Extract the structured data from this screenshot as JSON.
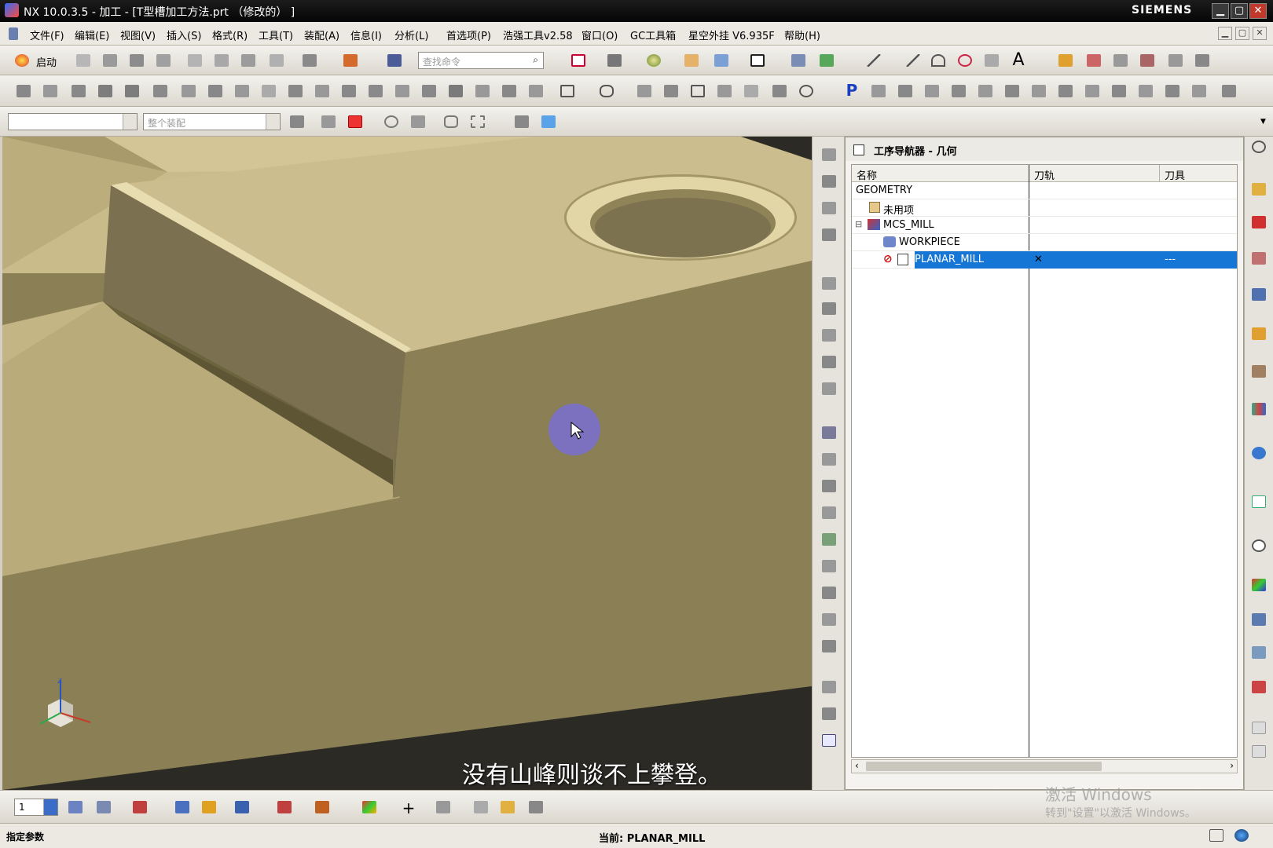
{
  "titlebar": {
    "title": "NX 10.0.3.5 - 加工 - [T型槽加工方法.prt （修改的） ]",
    "brand": "SIEMENS",
    "min": "▁",
    "max": "▢",
    "close": "✕"
  },
  "menu": [
    "文件(F)",
    "编辑(E)",
    "视图(V)",
    "插入(S)",
    "格式(R)",
    "工具(T)",
    "装配(A)",
    "信息(I)",
    "分析(L)",
    "首选项(P)",
    "浩强工具v2.58",
    "窗口(O)",
    "GC工具箱",
    "星空外挂 V6.935F",
    "帮助(H)"
  ],
  "toolbar": {
    "start_label": "启动",
    "search_placeholder": "查找命令",
    "filter_combo": "",
    "assembly_combo": "整个装配"
  },
  "viewport": {
    "subtitle": "没有山峰则谈不上攀登。"
  },
  "navigator": {
    "title": "工序导航器 - 几何",
    "columns": [
      "名称",
      "刀轨",
      "刀具"
    ],
    "rows": [
      {
        "name": "GEOMETRY",
        "path": "",
        "tool": ""
      },
      {
        "name": "未用项",
        "path": "",
        "tool": ""
      },
      {
        "name": "MCS_MILL",
        "path": "",
        "tool": ""
      },
      {
        "name": "WORKPIECE",
        "path": "",
        "tool": ""
      },
      {
        "name": "PLANAR_MILL",
        "path": "✕",
        "tool": "---"
      }
    ],
    "expand_sign": "⊟",
    "scroll_left": "‹",
    "scroll_right": "›"
  },
  "bottom": {
    "layer_value": "1"
  },
  "status": {
    "prompt": "指定参数",
    "current": "当前: PLANAR_MILL"
  },
  "watermark": {
    "line1": "激活 Windows",
    "line2": "转到\"设置\"以激活 Windows。"
  }
}
